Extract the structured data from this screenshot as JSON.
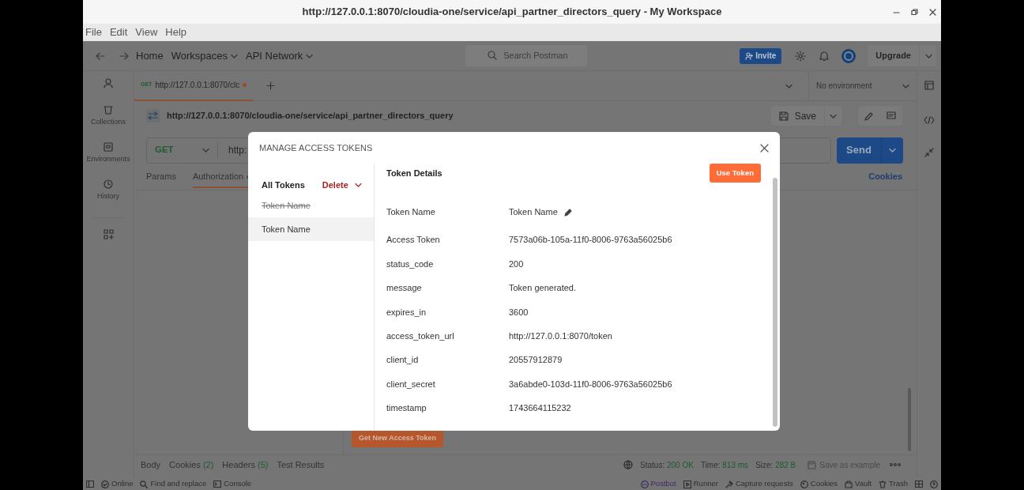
{
  "window": {
    "title": "http://127.0.0.1:8070/cloudia-one/service/api_partner_directors_query - My Workspace",
    "menu": [
      "File",
      "Edit",
      "View",
      "Help"
    ]
  },
  "header": {
    "nav": [
      {
        "label": "Home",
        "dropdown": false
      },
      {
        "label": "Workspaces",
        "dropdown": true
      },
      {
        "label": "API Network",
        "dropdown": true
      }
    ],
    "search": {
      "placeholder": "Search Postman"
    },
    "invite": "Invite",
    "upgrade": "Upgrade"
  },
  "sidebar": {
    "items": [
      {
        "label": "Collections"
      },
      {
        "label": "Environments"
      },
      {
        "label": "History"
      }
    ]
  },
  "request_tabs": [
    {
      "method": "GET",
      "label": "http://127.0.0.1:8070/clc",
      "unsaved": true,
      "selected": true
    }
  ],
  "environment": "No environment",
  "request": {
    "name": "http://127.0.0.1:8070/cloudia-one/service/api_partner_directors_query",
    "save": "Save",
    "method": "GET",
    "url": "http:",
    "send": "Send"
  },
  "request_sections": [
    {
      "label": "Params",
      "selected": false,
      "dot": false
    },
    {
      "label": "Authorization",
      "selected": true,
      "dot": true
    }
  ],
  "cookies_link": "Cookies",
  "get_token_button": "Get New Access Token",
  "response": {
    "tabs": [
      {
        "label": "Body"
      },
      {
        "label": "Cookies",
        "count": "(2)"
      },
      {
        "label": "Headers",
        "count": "(5)"
      },
      {
        "label": "Test Results"
      }
    ],
    "stats": [
      {
        "label": "Status:",
        "value": "200 OK"
      },
      {
        "label": "Time:",
        "value": "813 ms"
      },
      {
        "label": "Size:",
        "value": "282 B"
      }
    ],
    "save_example": "Save as example"
  },
  "status_bar": {
    "left": [
      "Online",
      "Find and replace",
      "Console"
    ],
    "right": [
      "Postbot",
      "Runner",
      "Capture requests",
      "Cookies",
      "Vault",
      "Trash"
    ]
  },
  "modal": {
    "title": "MANAGE ACCESS TOKENS",
    "list_title": "All Tokens",
    "delete": "Delete",
    "tokens": [
      {
        "name": "Token Name",
        "expired": true,
        "selected": false
      },
      {
        "name": "Token Name",
        "expired": false,
        "selected": true
      }
    ],
    "details_title": "Token Details",
    "use_token": "Use Token",
    "fields": [
      {
        "label": "Token Name",
        "value": "Token Name",
        "editable": true
      },
      {
        "label": "Access Token",
        "value": "7573a06b-105a-11f0-8006-9763a56025b6",
        "editable": false
      },
      {
        "label": "status_code",
        "value": "200",
        "editable": false
      },
      {
        "label": "message",
        "value": "Token generated.",
        "editable": false
      },
      {
        "label": "expires_in",
        "value": "3600",
        "editable": false
      },
      {
        "label": "access_token_url",
        "value": "http://127.0.0.1:8070/token",
        "editable": false
      },
      {
        "label": "client_id",
        "value": "20557912879",
        "editable": false
      },
      {
        "label": "client_secret",
        "value": "3a6abde0-103d-11f0-8006-9763a56025b6",
        "editable": false
      },
      {
        "label": "timestamp",
        "value": "1743664115232",
        "editable": false
      }
    ]
  }
}
